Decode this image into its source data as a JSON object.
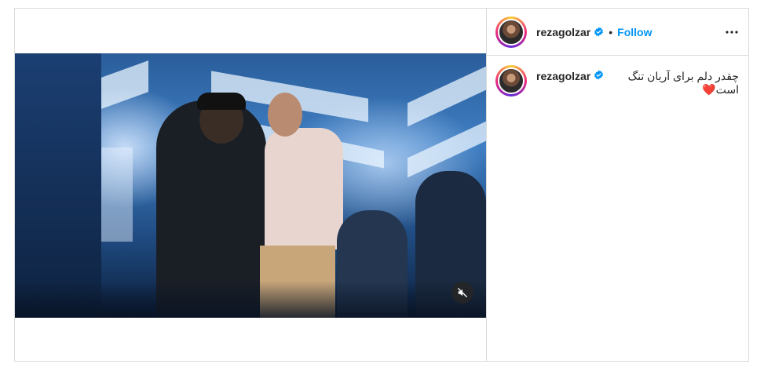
{
  "post": {
    "username": "rezagolzar",
    "separator": "•",
    "follow_label": "Follow",
    "caption": "چقدر دلم برای آریان تنگ است❤️",
    "icons": {
      "verified": "verified-badge-icon",
      "more": "more-options-icon",
      "mute": "sound-off-icon"
    },
    "colors": {
      "follow": "#0095f6",
      "verified": "#0095f6",
      "border": "#dbdbdb"
    }
  }
}
